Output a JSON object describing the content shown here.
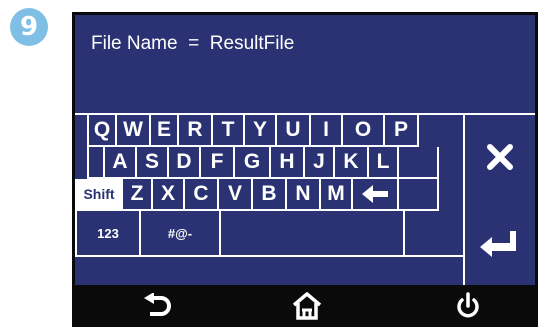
{
  "step": {
    "number": "9"
  },
  "display": {
    "text": "File Name  =  ResultFile"
  },
  "keyboard": {
    "row1": [
      "Q",
      "W",
      "E",
      "R",
      "T",
      "Y",
      "U",
      "I",
      "O",
      "P"
    ],
    "row2": [
      "A",
      "S",
      "D",
      "F",
      "G",
      "H",
      "J",
      "K",
      "L"
    ],
    "row3": [
      "Shift",
      "Z",
      "X",
      "C",
      "V",
      "B",
      "N",
      "M"
    ],
    "row4": [
      "123",
      "#@-"
    ]
  },
  "icons": {
    "clear": "close-icon",
    "enter": "enter-icon",
    "backspace": "arrow-left-icon",
    "back": "back-icon",
    "home": "home-icon",
    "power": "power-icon"
  },
  "colors": {
    "panel": "#2a3273",
    "frame": "#0a0a0a",
    "badge": "#7fbfe6",
    "key_text": "#ffffff"
  }
}
